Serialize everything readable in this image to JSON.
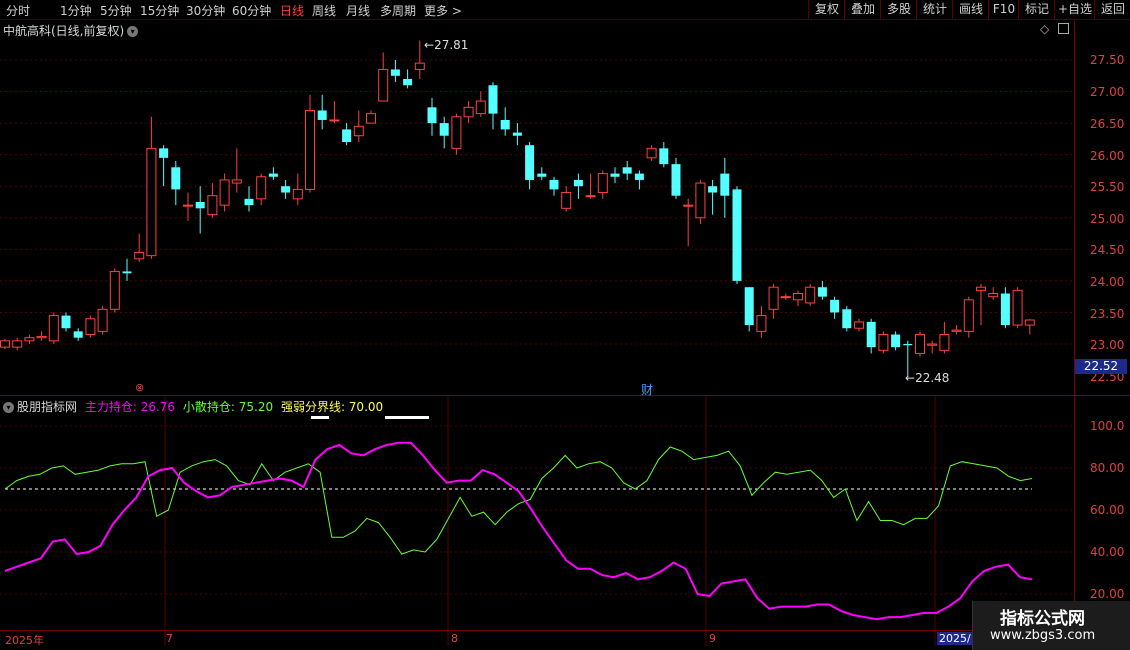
{
  "toolbar": {
    "periods": [
      "分时",
      "1分钟",
      "5分钟",
      "15分钟",
      "30分钟",
      "60分钟",
      "日线",
      "周线",
      "月线",
      "多周期",
      "更多 >"
    ],
    "active_period": "日线",
    "right_buttons": [
      "复权",
      "叠加",
      "多股",
      "统计",
      "画线",
      "F10",
      "+自选",
      "返回"
    ],
    "extra_button": "标记"
  },
  "chart_header": {
    "title": "中航高科(日线,前复权)",
    "collapse_icon": "chevron-down-icon"
  },
  "price_axis": [
    "27.50",
    "27.00",
    "26.50",
    "26.00",
    "25.50",
    "25.00",
    "24.50",
    "24.00",
    "23.50",
    "23.00",
    "22.50"
  ],
  "current_price": "22.52",
  "high_marker": "27.81",
  "low_marker": "22.48",
  "event_markers": [
    {
      "text": "⊗",
      "color": "#e04040"
    },
    {
      "text": "财",
      "color": "#40a0ff"
    }
  ],
  "indicator": {
    "name": "股朋指标网",
    "main_label": "主力持仓: 26.76",
    "retail_label": "小散持仓: 75.20",
    "threshold_label": "强弱分界线: 70.00"
  },
  "indicator_axis": [
    "100.0",
    "80.00",
    "60.00",
    "40.00",
    "20.00"
  ],
  "date_axis": [
    "2025年",
    "7",
    "8",
    "9",
    "2025/"
  ],
  "watermark": {
    "line1": "指标公式网",
    "line2": "www.zbgs3.com"
  },
  "colors": {
    "up": "#ff4040",
    "down": "#54ffff",
    "main": "#ff00ff",
    "retail": "#66ff33",
    "threshold": "#ffffff"
  },
  "chart_data": {
    "type": "candlestick",
    "title": "中航高科(日线,前复权)",
    "ylim": [
      22.3,
      27.9
    ],
    "candles": [
      [
        22.95,
        23.05,
        23.08,
        22.92
      ],
      [
        22.95,
        23.05,
        23.1,
        22.9
      ],
      [
        23.05,
        23.1,
        23.15,
        23.0
      ],
      [
        23.1,
        23.12,
        23.2,
        23.05
      ],
      [
        23.05,
        23.45,
        23.5,
        23.0
      ],
      [
        23.45,
        23.25,
        23.5,
        23.2
      ],
      [
        23.2,
        23.1,
        23.25,
        23.05
      ],
      [
        23.15,
        23.4,
        23.45,
        23.1
      ],
      [
        23.2,
        23.55,
        23.6,
        23.15
      ],
      [
        23.55,
        24.15,
        24.2,
        23.5
      ],
      [
        24.15,
        24.12,
        24.35,
        24.0
      ],
      [
        24.35,
        24.45,
        24.75,
        24.3
      ],
      [
        24.4,
        26.1,
        26.6,
        24.35
      ],
      [
        26.1,
        25.95,
        26.15,
        25.5
      ],
      [
        25.8,
        25.45,
        25.9,
        25.2
      ],
      [
        25.2,
        25.2,
        25.4,
        24.95
      ],
      [
        25.25,
        25.15,
        25.5,
        24.75
      ],
      [
        25.05,
        25.35,
        25.55,
        25.0
      ],
      [
        25.2,
        25.6,
        25.7,
        25.1
      ],
      [
        25.55,
        25.6,
        26.1,
        25.4
      ],
      [
        25.3,
        25.2,
        25.5,
        25.1
      ],
      [
        25.3,
        25.65,
        25.7,
        25.2
      ],
      [
        25.7,
        25.65,
        25.8,
        25.6
      ],
      [
        25.5,
        25.4,
        25.6,
        25.3
      ],
      [
        25.3,
        25.45,
        25.7,
        25.2
      ],
      [
        25.45,
        26.7,
        26.95,
        25.4
      ],
      [
        26.7,
        26.55,
        26.95,
        26.4
      ],
      [
        26.55,
        26.55,
        26.85,
        26.5
      ],
      [
        26.4,
        26.2,
        26.5,
        26.15
      ],
      [
        26.3,
        26.45,
        26.7,
        26.2
      ],
      [
        26.5,
        26.65,
        26.7,
        26.5
      ],
      [
        26.85,
        27.35,
        27.62,
        26.85
      ],
      [
        27.35,
        27.25,
        27.5,
        27.15
      ],
      [
        27.2,
        27.1,
        27.35,
        27.05
      ],
      [
        27.35,
        27.45,
        27.81,
        27.2
      ],
      [
        26.75,
        26.5,
        26.9,
        26.3
      ],
      [
        26.5,
        26.3,
        26.6,
        26.1
      ],
      [
        26.1,
        26.6,
        26.65,
        26.0
      ],
      [
        26.6,
        26.75,
        26.85,
        26.5
      ],
      [
        26.65,
        26.85,
        27.0,
        26.6
      ],
      [
        27.1,
        26.65,
        27.15,
        26.4
      ],
      [
        26.55,
        26.4,
        26.75,
        26.3
      ],
      [
        26.35,
        26.3,
        26.5,
        26.15
      ],
      [
        26.15,
        25.6,
        26.2,
        25.45
      ],
      [
        25.7,
        25.65,
        25.8,
        25.6
      ],
      [
        25.6,
        25.45,
        25.65,
        25.35
      ],
      [
        25.15,
        25.4,
        25.5,
        25.1
      ],
      [
        25.6,
        25.5,
        25.7,
        25.3
      ],
      [
        25.35,
        25.35,
        25.7,
        25.3
      ],
      [
        25.4,
        25.7,
        25.75,
        25.3
      ],
      [
        25.7,
        25.65,
        25.8,
        25.55
      ],
      [
        25.8,
        25.7,
        25.9,
        25.6
      ],
      [
        25.7,
        25.6,
        25.75,
        25.45
      ],
      [
        25.95,
        26.1,
        26.15,
        25.9
      ],
      [
        26.1,
        25.85,
        26.2,
        25.8
      ],
      [
        25.85,
        25.35,
        25.95,
        25.3
      ],
      [
        25.2,
        25.2,
        25.3,
        24.55
      ],
      [
        25.0,
        25.55,
        25.6,
        24.9
      ],
      [
        25.5,
        25.4,
        25.6,
        25.05
      ],
      [
        25.7,
        25.35,
        25.95,
        25.0
      ],
      [
        25.45,
        24.0,
        25.5,
        23.95
      ],
      [
        23.9,
        23.3,
        23.9,
        23.2
      ],
      [
        23.2,
        23.45,
        23.6,
        23.1
      ],
      [
        23.55,
        23.9,
        23.95,
        23.4
      ],
      [
        23.75,
        23.75,
        23.8,
        23.7
      ],
      [
        23.7,
        23.8,
        23.85,
        23.6
      ],
      [
        23.65,
        23.9,
        23.95,
        23.6
      ],
      [
        23.9,
        23.75,
        24.0,
        23.7
      ],
      [
        23.7,
        23.5,
        23.75,
        23.4
      ],
      [
        23.55,
        23.25,
        23.6,
        23.2
      ],
      [
        23.25,
        23.35,
        23.4,
        23.2
      ],
      [
        23.35,
        22.95,
        23.4,
        22.85
      ],
      [
        22.9,
        23.15,
        23.2,
        22.85
      ],
      [
        23.15,
        22.95,
        23.2,
        22.9
      ],
      [
        23.0,
        22.98,
        23.05,
        22.48
      ],
      [
        22.85,
        23.15,
        23.2,
        22.8
      ],
      [
        22.98,
        23.0,
        23.05,
        22.85
      ],
      [
        22.9,
        23.15,
        23.35,
        22.85
      ],
      [
        23.2,
        23.22,
        23.3,
        23.15
      ],
      [
        23.2,
        23.7,
        23.75,
        23.1
      ],
      [
        23.85,
        23.9,
        23.95,
        23.3
      ],
      [
        23.75,
        23.8,
        23.9,
        23.7
      ],
      [
        23.8,
        23.3,
        23.9,
        23.25
      ],
      [
        23.3,
        23.85,
        23.9,
        23.25
      ],
      [
        23.3,
        23.38,
        23.4,
        23.15
      ]
    ],
    "main_line": [
      31,
      33,
      35,
      37,
      45,
      46,
      39,
      40,
      43,
      53,
      60,
      66,
      76,
      79,
      80,
      73,
      69,
      66,
      67,
      71,
      72,
      73,
      74,
      75,
      74,
      71,
      84,
      89,
      91,
      87,
      86,
      89,
      91,
      92,
      92,
      86,
      79,
      73,
      74,
      74,
      79,
      77,
      73,
      69,
      61,
      52,
      44,
      36,
      32,
      32,
      29,
      28,
      30,
      27,
      28,
      31,
      35,
      32,
      20,
      19,
      25,
      26,
      27,
      18,
      13,
      14,
      14,
      14,
      15,
      15,
      12,
      10,
      9,
      8,
      9,
      9,
      10,
      11,
      11,
      14,
      18,
      26,
      31,
      33,
      34,
      28,
      27
    ],
    "retail_line": [
      70,
      74,
      76,
      77,
      80,
      81,
      77,
      78,
      79,
      81,
      82,
      82,
      83,
      57,
      60,
      78,
      81,
      83,
      84,
      81,
      74,
      72,
      82,
      74,
      78,
      80,
      82,
      78,
      47,
      47,
      50,
      56,
      54,
      47,
      39,
      41,
      40,
      46,
      56,
      66,
      57,
      59,
      53,
      59,
      63,
      65,
      75,
      80,
      86,
      80,
      82,
      83,
      80,
      73,
      70,
      74,
      84,
      90,
      88,
      84,
      85,
      86,
      88,
      81,
      67,
      73,
      78,
      77,
      78,
      79,
      74,
      66,
      70,
      55,
      64,
      55,
      55,
      53,
      56,
      56,
      62,
      81,
      83,
      82,
      81,
      80,
      76,
      74,
      75
    ],
    "threshold": 70,
    "ind_ylim": [
      20,
      100
    ]
  }
}
